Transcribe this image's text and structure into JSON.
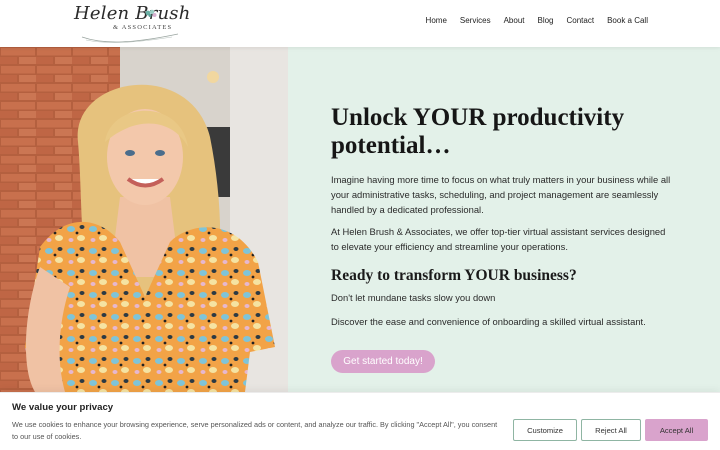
{
  "brand": {
    "name": "Helen Brush",
    "subtitle": "& ASSOCIATES"
  },
  "nav": {
    "items": [
      {
        "label": "Home"
      },
      {
        "label": "Services"
      },
      {
        "label": "About"
      },
      {
        "label": "Blog"
      },
      {
        "label": "Contact"
      },
      {
        "label": "Book a Call"
      }
    ]
  },
  "hero": {
    "heading": "Unlock YOUR productivity potential…",
    "paragraph1": "Imagine having more time to focus on what truly matters in your business while all your administrative tasks, scheduling, and project management are seamlessly handled by a dedicated professional.",
    "paragraph2": "At Helen Brush & Associates, we offer top-tier virtual assistant services designed to elevate your efficiency and streamline your operations.",
    "subheading": "Ready to transform YOUR business?",
    "paragraph3": "Don't let mundane tasks slow you down",
    "paragraph4": "Discover the ease and convenience of onboarding a skilled virtual assistant.",
    "cta_label": "Get started today!"
  },
  "cookie_banner": {
    "title": "We value your privacy",
    "text": "We use cookies to enhance your browsing experience, serve personalized ads or content, and analyze our traffic. By clicking \"Accept All\", you consent to our use of cookies.",
    "customize_label": "Customize",
    "reject_label": "Reject All",
    "accept_label": "Accept All"
  },
  "colors": {
    "accent_pink": "#d9a3cc",
    "panel_green": "#e3f1e9",
    "button_border_green": "#8fb5a3"
  }
}
